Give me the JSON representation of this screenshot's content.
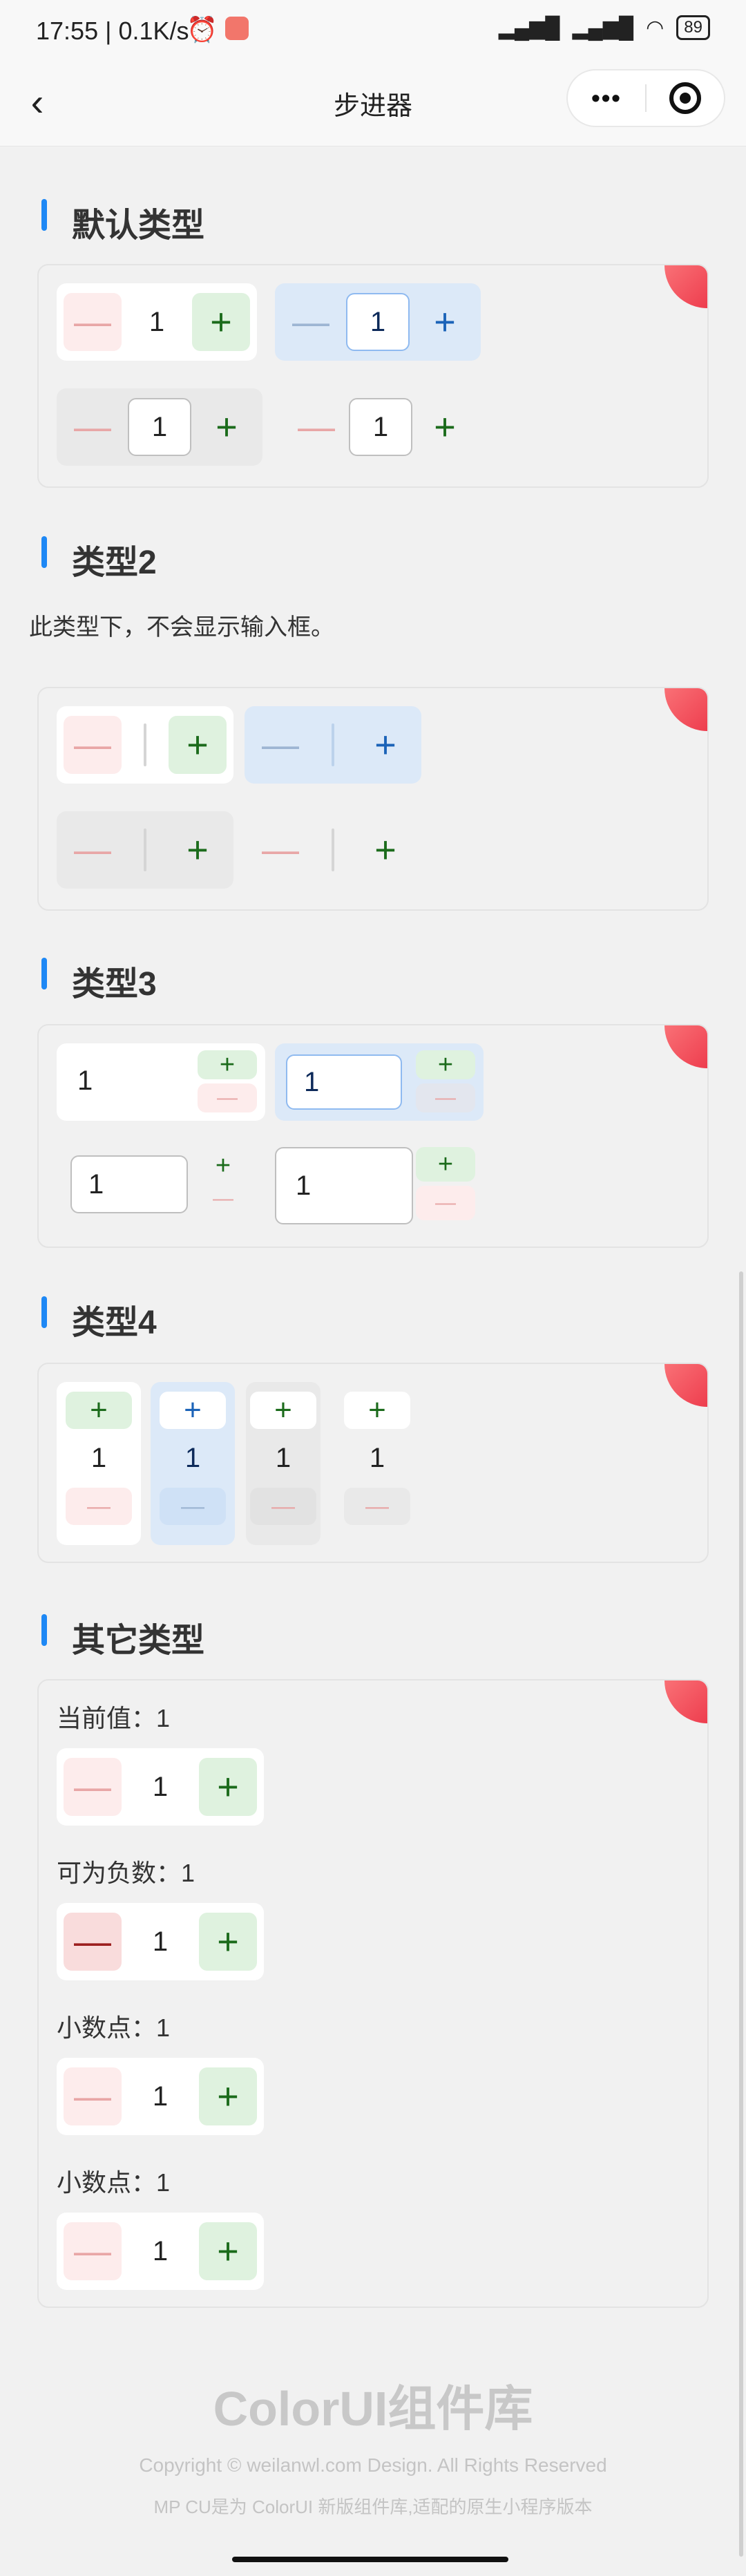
{
  "status": {
    "time": "17:55 | 0.1K/s",
    "battery": "89"
  },
  "nav": {
    "title": "步进器",
    "back_glyph": "‹",
    "more_glyph": "•••"
  },
  "sections": {
    "default": {
      "title": "默认类型"
    },
    "type2": {
      "title": "类型2",
      "note": "此类型下，不会显示输入框。"
    },
    "type3": {
      "title": "类型3"
    },
    "type4": {
      "title": "类型4"
    },
    "other": {
      "title": "其它类型"
    }
  },
  "stepper": {
    "minus": "—",
    "plus": "+",
    "value": "1"
  },
  "other": {
    "current_label": "当前值：1",
    "negative_label": "可为负数：1",
    "decimal_label_1": "小数点：1",
    "decimal_label_2": "小数点：1"
  },
  "footer": {
    "logo": "ColorUI组件库",
    "copyright": "Copyright © weilanwl.com Design. All Rights Reserved",
    "sub": "MP CU是为 ColorUI 新版组件库,适配的原生小程序版本"
  },
  "colors": {
    "accent": "#1e88f5",
    "plus_bg": "#dff2df",
    "minus_bg": "#fdecec",
    "blue_bg": "#dce9f8"
  }
}
